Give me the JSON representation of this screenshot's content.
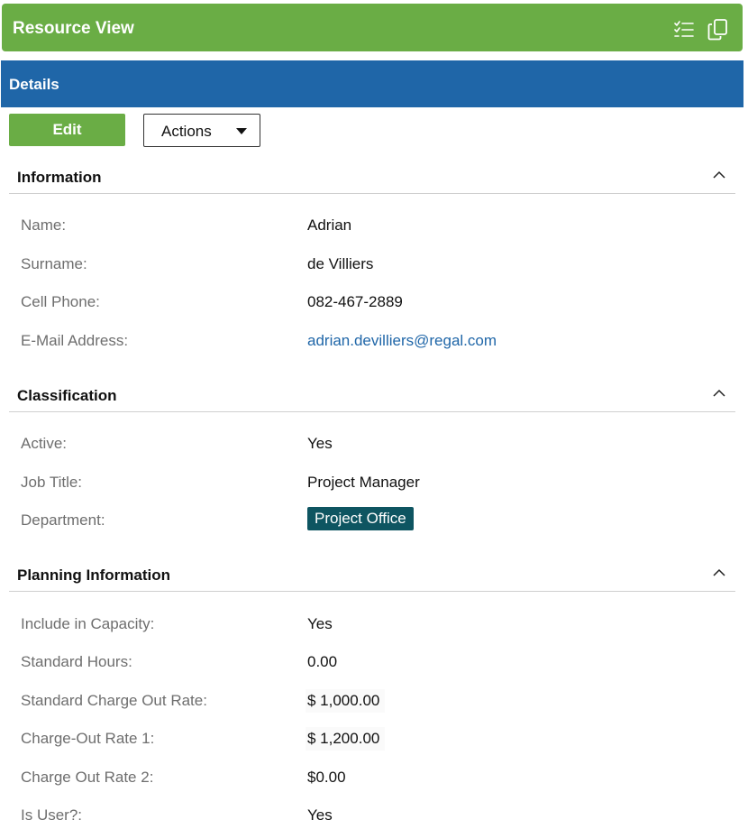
{
  "window": {
    "title": "Resource View",
    "icons": [
      "checklist-icon",
      "copy-icon"
    ]
  },
  "details_bar": {
    "label": "Details"
  },
  "toolbar": {
    "edit_label": "Edit",
    "actions_label": "Actions"
  },
  "sections": [
    {
      "title": "Information",
      "rows": [
        {
          "label": "Name:",
          "value": "Adrian"
        },
        {
          "label": "Surname:",
          "value": "de Villiers"
        },
        {
          "label": "Cell Phone:",
          "value": "082-467-2889"
        },
        {
          "label": "E-Mail Address:",
          "value": "adrian.devilliers@regal.com"
        }
      ]
    },
    {
      "title": "Classification",
      "rows": [
        {
          "label": "Active:",
          "value": "Yes"
        },
        {
          "label": "Job Title:",
          "value": "Project Manager"
        },
        {
          "label": "Department:",
          "value": "Project Office"
        }
      ]
    },
    {
      "title": "Planning Information",
      "rows": [
        {
          "label": "Include in Capacity:",
          "value": "Yes"
        },
        {
          "label": "Standard Hours:",
          "value": "0.00"
        },
        {
          "label": "Standard Charge Out Rate:",
          "value": "$ 1,000.00"
        },
        {
          "label": "Charge-Out Rate 1:",
          "value": "$ 1,200.00"
        },
        {
          "label": "Charge Out Rate 2:",
          "value": "$0.00"
        },
        {
          "label": "Is User?:",
          "value": "Yes"
        }
      ]
    }
  ],
  "colors": {
    "title_bar": "#6aad45",
    "details_bar": "#1f66a8",
    "link": "#1f66a8",
    "department_tag": "#0e5561"
  }
}
